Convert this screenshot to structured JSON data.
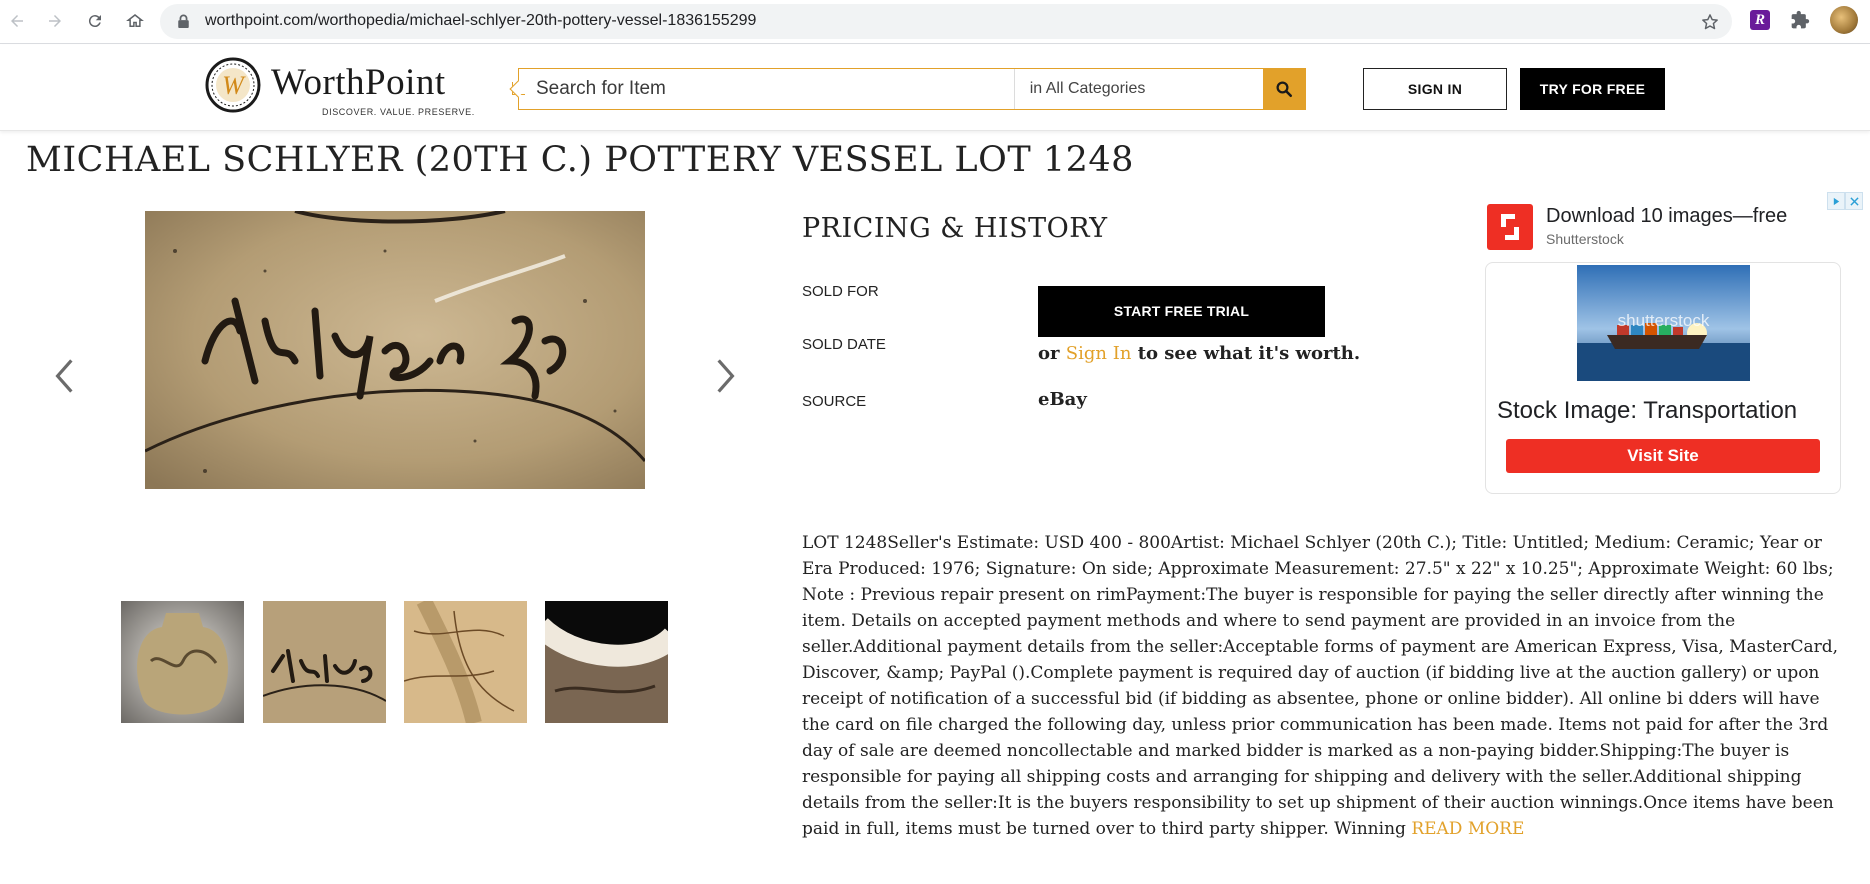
{
  "browser": {
    "url": "worthpoint.com/worthopedia/michael-schlyer-20th-pottery-vessel-1836155299",
    "extension_letter": "R"
  },
  "header": {
    "logo_word": "WorthPoint",
    "logo_tagline": "DISCOVER. VALUE. PRESERVE.",
    "search_placeholder": "Search for Item",
    "search_category": "in All Categories",
    "sign_in_label": "SIGN IN",
    "try_free_label": "TRY FOR FREE"
  },
  "page": {
    "title": "MICHAEL SCHLYER (20TH C.) POTTERY VESSEL LOT 1248"
  },
  "pricing": {
    "heading": "PRICING & HISTORY",
    "sold_for_label": "SOLD FOR",
    "sold_date_label": "SOLD DATE",
    "source_label": "SOURCE",
    "trial_button": "START FREE TRIAL",
    "or_text": "or",
    "sign_in_link": "Sign In",
    "worth_text": "to see what it's worth.",
    "source_value": "eBay"
  },
  "ad": {
    "headline": "Download 10 images—free",
    "advertiser": "Shutterstock",
    "image_watermark": "shutterstock",
    "title": "Stock Image: Transportation",
    "cta": "Visit Site"
  },
  "description": {
    "text": "LOT 1248Seller's Estimate: USD 400 - 800Artist: Michael Schlyer (20th C.); Title: Untitled; Medium: Ceramic; Year or Era Produced: 1976; Signature: On side; Approximate Measurement: 27.5\" x 22\" x 10.25\"; Approximate Weight: 60 lbs; Note : Previous repair present on rimPayment:The buyer is responsible for paying the seller directly after winning the item. Details on accepted payment methods and where to send payment are provided in an invoice from the seller.Additional payment details from the seller:Acceptable forms of payment are American Express, Visa, MasterCard, Discover, &amp; PayPal ().Complete payment is required day of auction (if bidding live at the auction gallery) or upon receipt of notification of a successful bid (if bidding as absentee, phone or online bidder). All online bi dders will have the card on file charged the following day, unless prior communication has been made. Items not paid for after the 3rd day of sale are deemed noncollectable and marked bidder is marked as a non-paying bidder.Shipping:The buyer is responsible for paying all shipping costs and arranging for shipping and delivery with the seller.Additional shipping details from the seller:It is the buyers responsibility to set up shipment of their auction winnings.Once items have been paid in full, items must be turned over to third party shipper. Winning",
    "read_more": "READ MORE"
  },
  "colors": {
    "accent": "#e2a12a",
    "ad_red": "#ee2f24",
    "button_black": "#000000"
  }
}
